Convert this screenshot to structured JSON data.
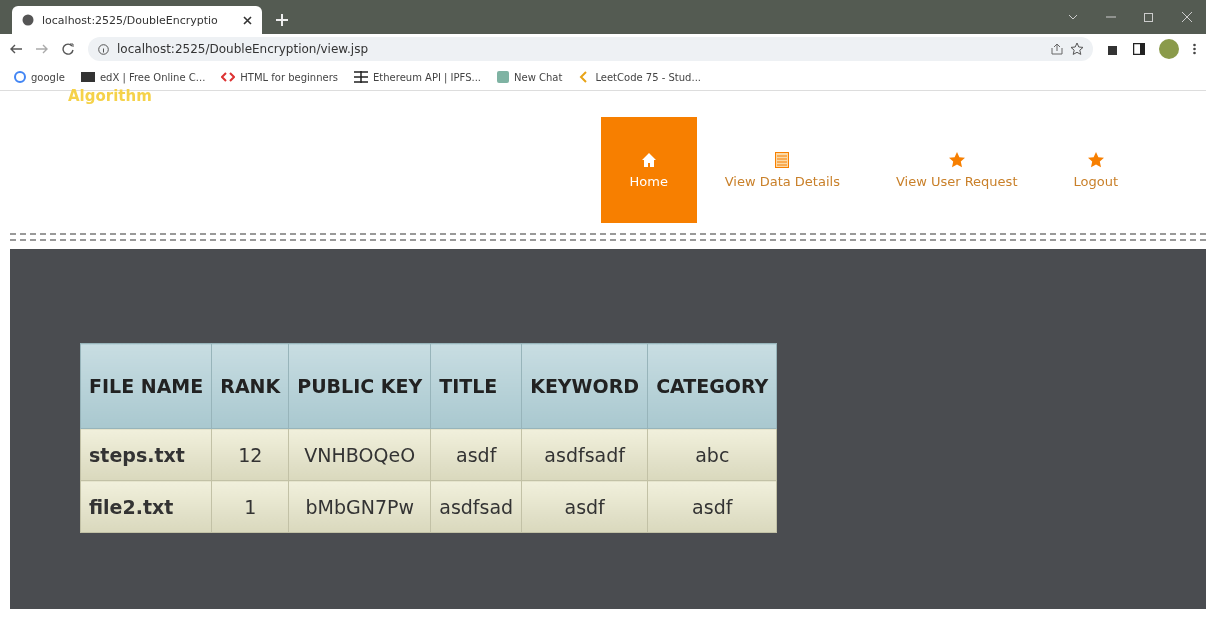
{
  "browser": {
    "tab_title": "localhost:2525/DoubleEncryptio",
    "url": "localhost:2525/DoubleEncryption/view.jsp",
    "bookmarks": [
      {
        "label": "google",
        "kind": "g"
      },
      {
        "label": "edX | Free Online C...",
        "kind": "edx"
      },
      {
        "label": "HTML for beginners",
        "kind": "code"
      },
      {
        "label": "Ethereum API | IPFS...",
        "kind": "eth"
      },
      {
        "label": "New Chat",
        "kind": "chat"
      },
      {
        "label": "LeetCode 75 - Stud...",
        "kind": "leet"
      }
    ]
  },
  "site": {
    "logo": "Algorithm"
  },
  "nav": [
    {
      "label": "Home",
      "kind": "home",
      "selected": true
    },
    {
      "label": "View Data Details",
      "kind": "table",
      "selected": false
    },
    {
      "label": "View User Request",
      "kind": "star",
      "selected": false
    },
    {
      "label": "Logout",
      "kind": "star",
      "selected": false
    }
  ],
  "table": {
    "columns": [
      "FILE NAME",
      "RANK",
      "PUBLIC KEY",
      "TITLE",
      "KEYWORD",
      "CATEGORY"
    ],
    "rows": [
      [
        "steps.txt",
        "12",
        "VNHBOQeO",
        "asdf",
        "asdfsadf",
        "abc"
      ],
      [
        "file2.txt",
        "1",
        "bMbGN7Pw",
        "asdfsad",
        "asdf",
        "asdf"
      ]
    ]
  }
}
